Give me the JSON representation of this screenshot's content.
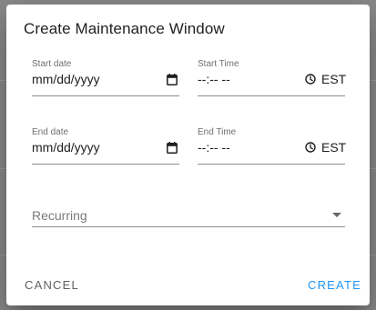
{
  "dialog": {
    "title": "Create Maintenance Window",
    "start_date": {
      "label": "Start date",
      "value": "mm/dd/yyyy",
      "icon": "calendar-icon"
    },
    "start_time": {
      "label": "Start Time",
      "value": "--:-- --",
      "icon": "clock-icon",
      "timezone": "EST"
    },
    "end_date": {
      "label": "End date",
      "value": "mm/dd/yyyy",
      "icon": "calendar-icon"
    },
    "end_time": {
      "label": "End Time",
      "value": "--:-- --",
      "icon": "clock-icon",
      "timezone": "EST"
    },
    "recurring": {
      "placeholder": "Recurring",
      "icon": "dropdown-arrow-icon"
    },
    "actions": {
      "cancel_label": "CANCEL",
      "create_label": "CREATE"
    }
  },
  "colors": {
    "primary": "#2196f3",
    "cancel_text": "#616161",
    "backdrop": "#8a8a8a"
  }
}
